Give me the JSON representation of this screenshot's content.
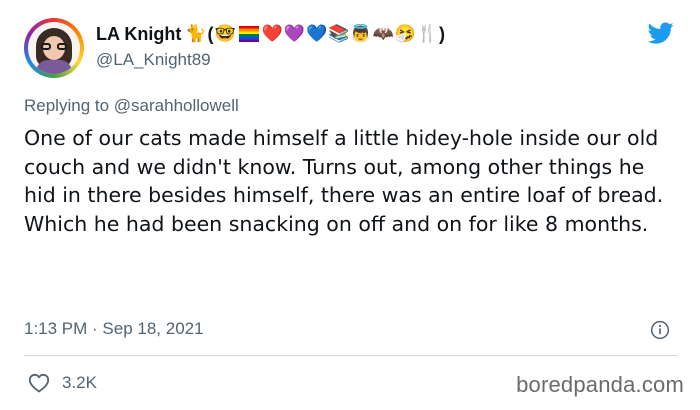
{
  "tweet": {
    "author": {
      "display_name": "LA Knight",
      "name_emojis": [
        "🐈",
        "(",
        "🤓",
        "🏳️‍🌈",
        "❤️",
        "💜",
        "💙",
        "📚",
        "👼",
        "🦇",
        "🤧",
        "🍴",
        ")"
      ],
      "handle": "@LA_Knight89"
    },
    "reply_prefix": "Replying to",
    "reply_to": "@sarahhollowell",
    "text": "One of our cats made himself a little hidey-hole inside our old couch and we didn't know. Turns out, among other things he hid in there besides himself, there was an entire loaf of bread. Which he had been snacking on off and on for like 8 months.",
    "timestamp": "1:13 PM · Sep 18, 2021",
    "likes": "3.2K"
  },
  "icons": {
    "avatar": "avatar",
    "brand": "twitter-bird-icon",
    "info": "info-icon",
    "like": "heart-icon"
  },
  "colors": {
    "twitter_blue": "#1d9bf0",
    "secondary_text": "#536471",
    "primary_text": "#0f1419",
    "divider": "#cfd9de",
    "watermark": "#6b6b6b"
  },
  "watermark": "boredpanda.com"
}
